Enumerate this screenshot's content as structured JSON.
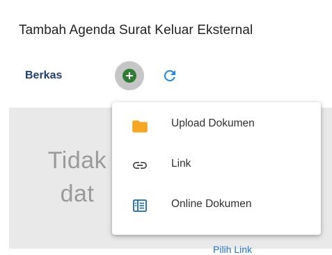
{
  "dialog": {
    "title": "Tambah Agenda Surat Keluar Eksternal"
  },
  "toolbar": {
    "tab_label": "Berkas",
    "add_icon": "add-circle-icon",
    "refresh_icon": "refresh-icon"
  },
  "content": {
    "empty_line1": "Tidak",
    "empty_line2": "dat",
    "bottom_link": "Pilih Link"
  },
  "menu": {
    "items": [
      {
        "label": "Upload Dokumen",
        "icon": "folder-icon",
        "icon_color": "#f5a623"
      },
      {
        "label": "Link",
        "icon": "link-icon",
        "icon_color": "#555555"
      },
      {
        "label": "Online Dokumen",
        "icon": "document-icon",
        "icon_color": "#1565c0"
      }
    ]
  },
  "colors": {
    "accent": "#1f3f73",
    "add_green": "#2e7d32",
    "refresh_blue": "#1e88e5"
  }
}
